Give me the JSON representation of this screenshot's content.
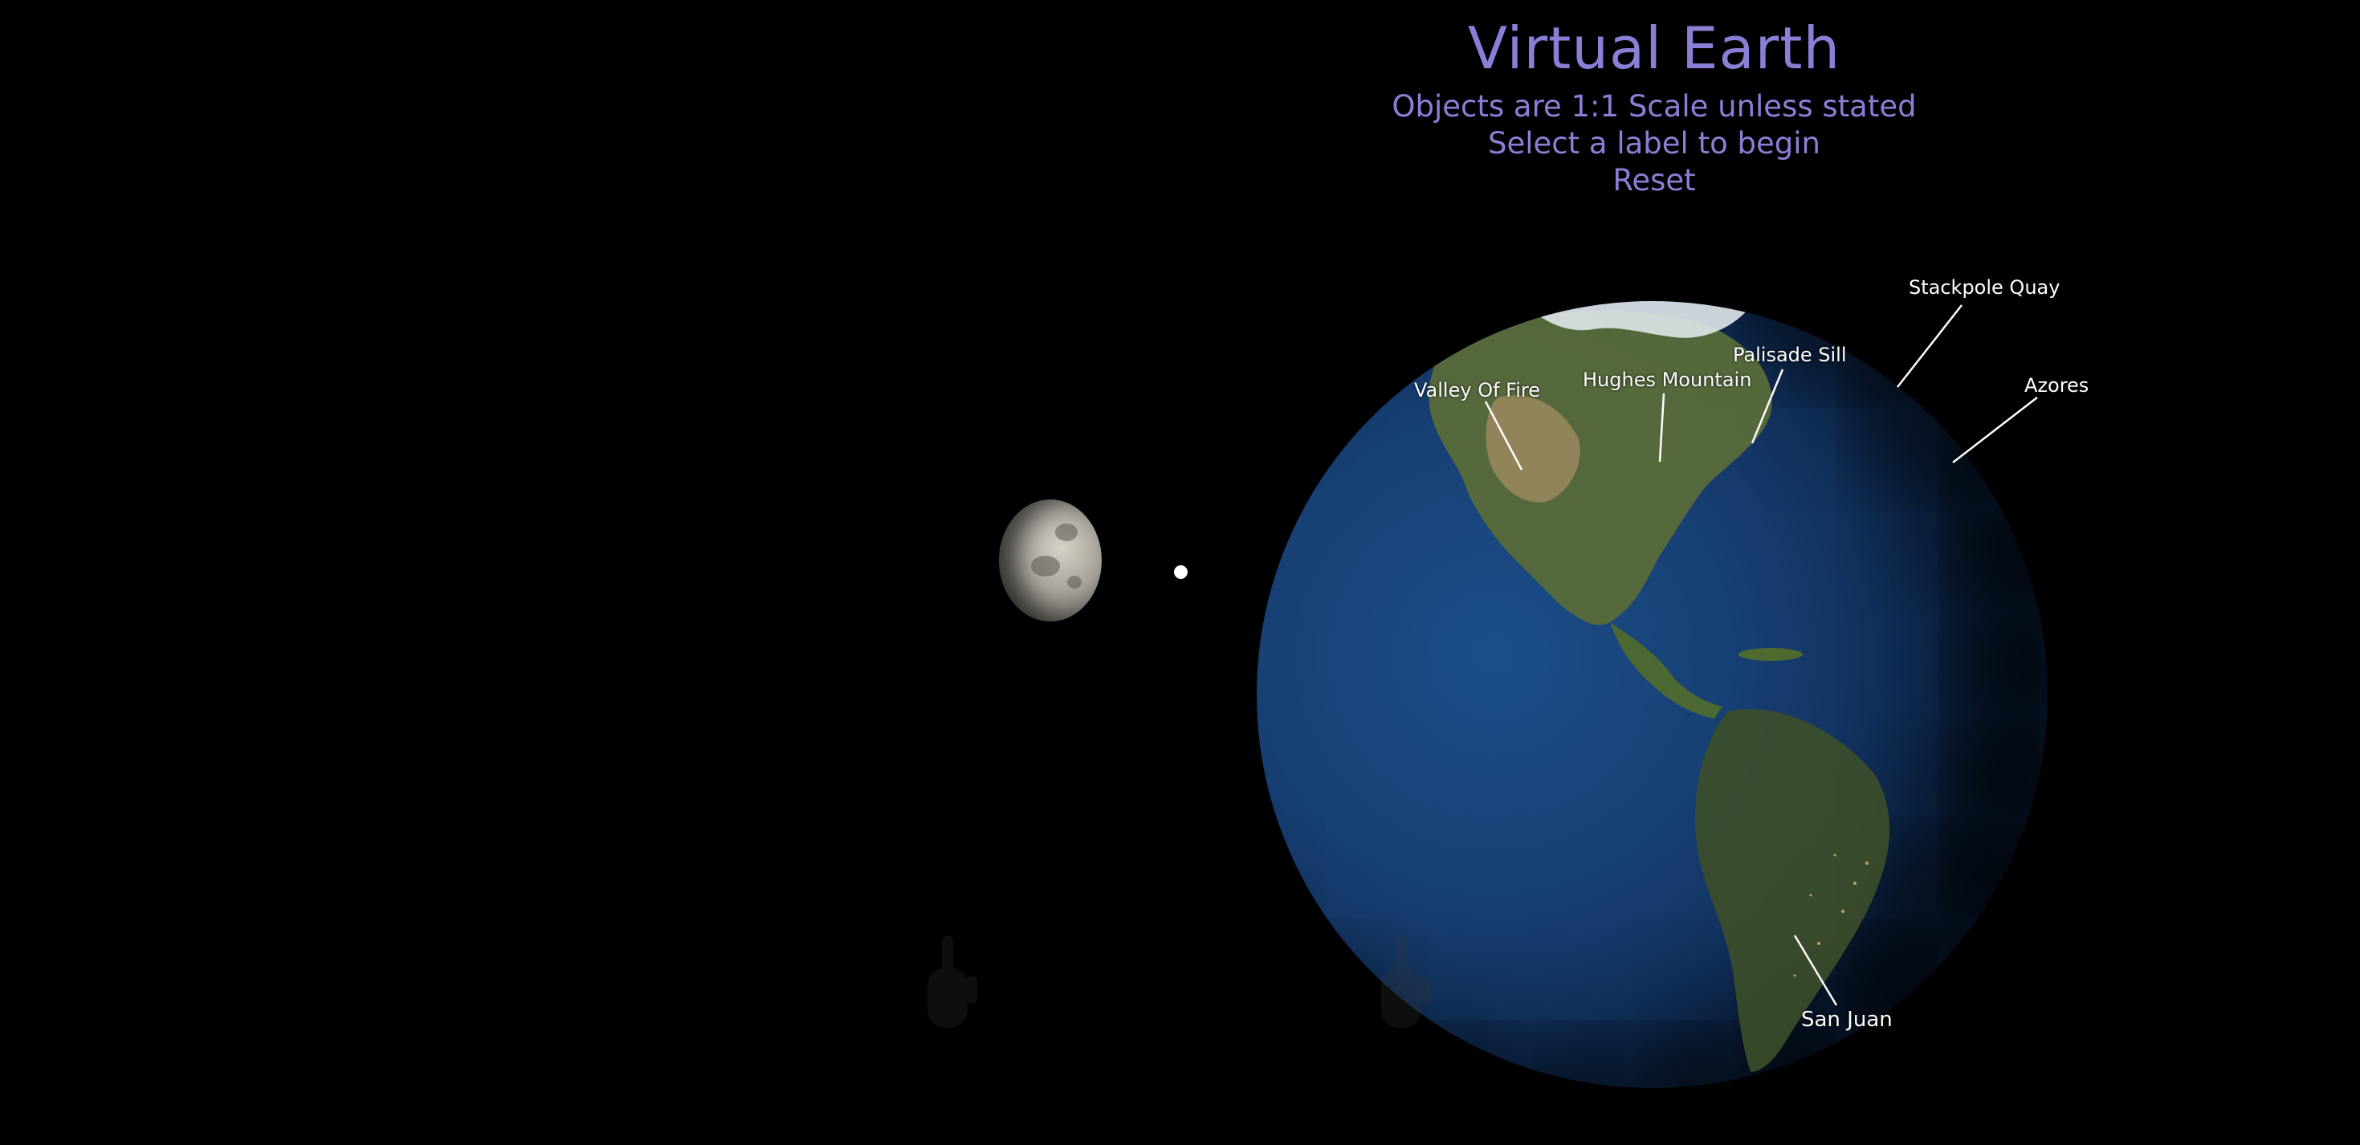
{
  "header": {
    "title": "Virtual Earth",
    "scale_note": "Objects are 1:1 Scale unless stated",
    "instruction": "Select a label to begin",
    "reset_label": "Reset"
  },
  "labels": [
    {
      "id": "stackpole-quay",
      "text": "Stackpole Quay"
    },
    {
      "id": "azores",
      "text": "Azores"
    },
    {
      "id": "palisade-sill",
      "text": "Palisade Sill"
    },
    {
      "id": "hughes-mountain",
      "text": "Hughes Mountain"
    },
    {
      "id": "valley-of-fire",
      "text": "Valley Of Fire"
    },
    {
      "id": "san-juan",
      "text": "San Juan"
    }
  ],
  "icons": {
    "earth": "earth-globe-icon",
    "moon": "moon-icon",
    "hand": "hand-pointer-icon"
  },
  "colors": {
    "title": "#8a7fd6",
    "background": "#000000",
    "label": "#ffffff"
  }
}
